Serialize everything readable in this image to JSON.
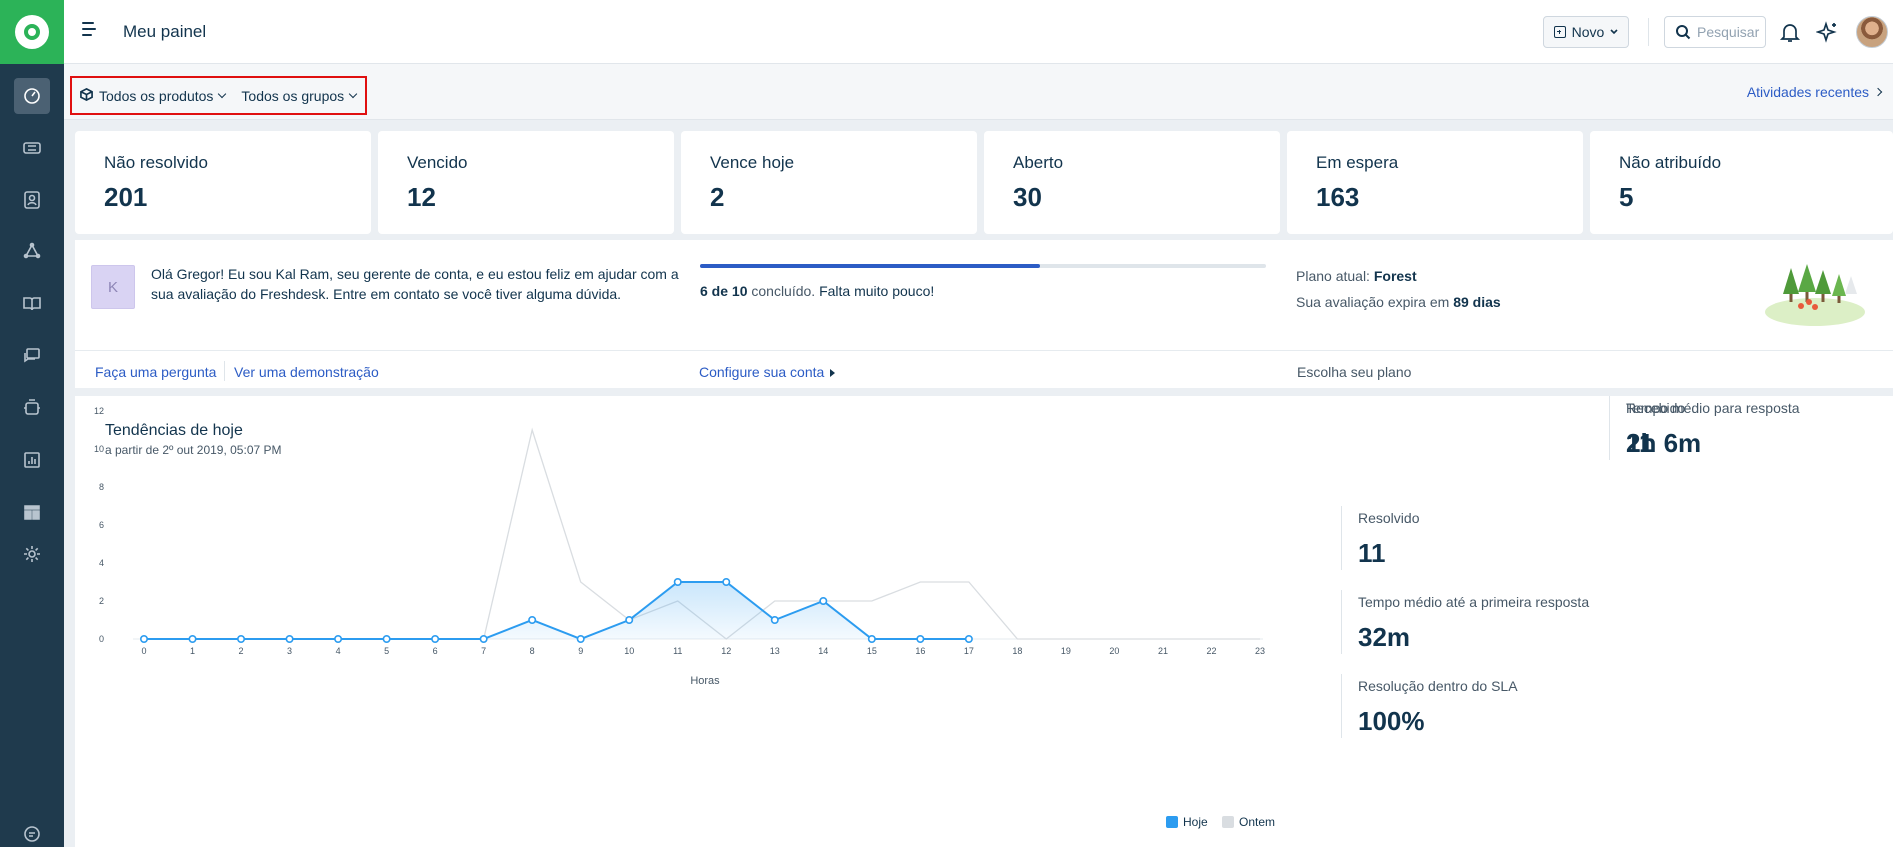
{
  "sidebar": {
    "items": [
      {
        "icon": "dashboard-icon",
        "active": true
      },
      {
        "icon": "ticket-icon",
        "active": false
      },
      {
        "icon": "contacts-icon",
        "active": false
      },
      {
        "icon": "social-icon",
        "active": false
      },
      {
        "icon": "solutions-book-icon",
        "active": false
      },
      {
        "icon": "forums-icon",
        "active": false
      },
      {
        "icon": "bot-icon",
        "active": false
      },
      {
        "icon": "reports-icon",
        "active": false
      },
      {
        "icon": "layout-icon",
        "active": false
      },
      {
        "icon": "gear-icon",
        "active": false
      },
      {
        "icon": "chat-icon",
        "active": false
      }
    ]
  },
  "header": {
    "title": "Meu painel",
    "new_button": "Novo",
    "search_placeholder": "Pesquisar"
  },
  "filters": {
    "products": "Todos os produtos",
    "groups": "Todos os grupos",
    "recent_activities": "Atividades recentes"
  },
  "stats": [
    {
      "label": "Não resolvido",
      "value": "201"
    },
    {
      "label": "Vencido",
      "value": "12"
    },
    {
      "label": "Vence hoje",
      "value": "2"
    },
    {
      "label": "Aberto",
      "value": "30"
    },
    {
      "label": "Em espera",
      "value": "163"
    },
    {
      "label": "Não atribuído",
      "value": "5"
    }
  ],
  "onboarding": {
    "avatar_letter": "K",
    "message": "Olá Gregor! Eu sou Kal Ram, seu gerente de conta, e eu estou feliz em ajudar com a sua avaliação do Freshdesk. Entre em contato se você tiver alguma dúvida.",
    "progress_fraction": 0.6,
    "progress_count": "6 de 10",
    "progress_status": "concluído.",
    "progress_note": "Falta muito pouco!",
    "plan_label": "Plano atual:",
    "plan_name": "Forest",
    "trial_label": "Sua avaliação expira em",
    "trial_days": "89 dias",
    "links": {
      "ask": "Faça uma pergunta",
      "demo": "Ver uma demonstração",
      "setup": "Configure sua conta",
      "plan": "Escolha seu plano"
    }
  },
  "trends": {
    "title": "Tendências de hoje",
    "subtitle": "a partir de 2º out 2019, 05:07 PM",
    "metrics": [
      {
        "label": "Resolvido",
        "value": "11"
      },
      {
        "label": "Recebido",
        "value": "11"
      },
      {
        "label": "Tempo médio até a primeira resposta",
        "value": "32m"
      },
      {
        "label": "Tempo médio para resposta",
        "value": "2h 6m"
      },
      {
        "label": "Resolução dentro do SLA",
        "value": "100%"
      }
    ]
  },
  "chart_data": {
    "type": "area",
    "xlabel": "Horas",
    "ylabel": "",
    "x": [
      0,
      1,
      2,
      3,
      4,
      5,
      6,
      7,
      8,
      9,
      10,
      11,
      12,
      13,
      14,
      15,
      16,
      17,
      18,
      19,
      20,
      21,
      22,
      23
    ],
    "ylim": [
      0,
      12
    ],
    "yticks": [
      0,
      2,
      4,
      6,
      8,
      10,
      12
    ],
    "grid": false,
    "legend": "bottom-right",
    "series": [
      {
        "name": "Hoje",
        "color": "#2c9cf0",
        "values": [
          0,
          0,
          0,
          0,
          0,
          0,
          0,
          0,
          1,
          0,
          1,
          3,
          3,
          1,
          2,
          0,
          0,
          0
        ]
      },
      {
        "name": "Ontem",
        "color": "#d9dde1",
        "values": [
          0,
          0,
          0,
          0,
          0,
          0,
          0,
          0,
          11,
          3,
          1,
          2,
          0,
          2,
          2,
          2,
          3,
          3,
          0,
          0,
          0,
          0,
          0,
          0
        ]
      }
    ]
  }
}
